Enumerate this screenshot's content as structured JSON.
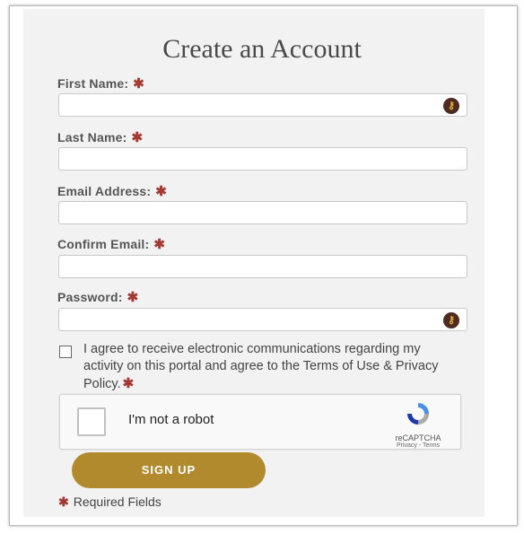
{
  "form": {
    "title": "Create an Account",
    "required_marker": "✱",
    "fields": {
      "first_name": {
        "label": "First Name:",
        "value": ""
      },
      "last_name": {
        "label": "Last Name:",
        "value": ""
      },
      "email": {
        "label": "Email Address:",
        "value": ""
      },
      "confirm_email": {
        "label": "Confirm Email:",
        "value": ""
      },
      "password": {
        "label": "Password:",
        "value": ""
      }
    },
    "agree_text": "I agree to receive electronic communications regarding my activity on this portal and agree to the Terms of Use & Privacy Policy.",
    "recaptcha": {
      "label": "I'm not a robot",
      "brand": "reCAPTCHA",
      "links": "Privacy - Terms"
    },
    "signup_label": "SIGN UP",
    "required_note": "Required Fields"
  },
  "icons": {
    "password_manager_icon": "key-icon",
    "recaptcha_icon": "recaptcha-logo-icon"
  },
  "colors": {
    "accent": "#b18a2e",
    "required": "#a33a34",
    "panel": "#f2f2f2"
  }
}
